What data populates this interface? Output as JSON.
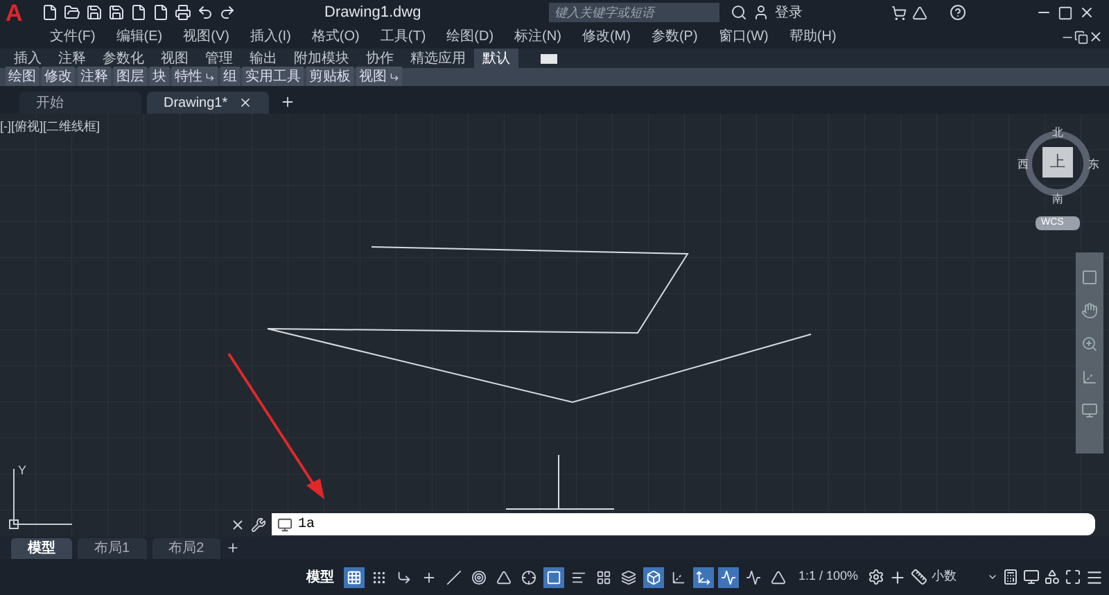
{
  "title_bar": {
    "app_letter": "A",
    "title": "Drawing1.dwg",
    "search": {
      "placeholder": "键入关键字或短语"
    },
    "sign_in": "登录"
  },
  "menu": [
    "文件(F)",
    "编辑(E)",
    "视图(V)",
    "插入(I)",
    "格式(O)",
    "工具(T)",
    "绘图(D)",
    "标注(N)",
    "修改(M)",
    "参数(P)",
    "窗口(W)",
    "帮助(H)"
  ],
  "ribbon_tabs": [
    {
      "label": "插入",
      "selected": false
    },
    {
      "label": "注释",
      "selected": false
    },
    {
      "label": "参数化",
      "selected": false
    },
    {
      "label": "视图",
      "selected": false
    },
    {
      "label": "管理",
      "selected": false
    },
    {
      "label": "输出",
      "selected": false
    },
    {
      "label": "附加模块",
      "selected": false
    },
    {
      "label": "协作",
      "selected": false
    },
    {
      "label": "精选应用",
      "selected": false
    },
    {
      "label": "默认",
      "selected": true
    }
  ],
  "panels": [
    {
      "label": "绘图",
      "more": false
    },
    {
      "label": "修改",
      "more": false
    },
    {
      "label": "注释",
      "more": false
    },
    {
      "label": "图层",
      "more": false
    },
    {
      "label": "块",
      "more": false
    },
    {
      "label": "特性",
      "more": true
    },
    {
      "label": "组",
      "more": false
    },
    {
      "label": "实用工具",
      "more": false
    },
    {
      "label": "剪贴板",
      "more": false
    },
    {
      "label": "视图",
      "more": true
    }
  ],
  "doc_tabs": [
    {
      "label": "开始",
      "selected": false,
      "closable": false
    },
    {
      "label": "Drawing1*",
      "selected": true,
      "closable": true
    }
  ],
  "viewport_label": "[-][俯视][二维线框]",
  "viewcube": {
    "north": "北",
    "south": "南",
    "east": "东",
    "west": "西",
    "face": "上",
    "ucs": "WCS"
  },
  "ucs_icon": {
    "y": "Y"
  },
  "command_line": {
    "value": "1a"
  },
  "layout_tabs": [
    {
      "label": "模型",
      "selected": true
    },
    {
      "label": "布局1",
      "selected": false
    },
    {
      "label": "布局2",
      "selected": false
    }
  ],
  "status_bar": {
    "model": "模型",
    "scale": "1:1 / 100%",
    "units": "小数",
    "toggles": [
      {
        "kind": "grid",
        "on": true
      },
      {
        "kind": "snap",
        "on": false
      },
      {
        "kind": "infer",
        "on": false
      },
      {
        "kind": "dynamic",
        "on": false
      },
      {
        "kind": "ortho",
        "on": false
      },
      {
        "kind": "polar",
        "on": false
      },
      {
        "kind": "isodraft",
        "on": false
      },
      {
        "kind": "objtrack",
        "on": false
      },
      {
        "kind": "osnap",
        "on": true
      },
      {
        "kind": "lineweight",
        "on": false
      },
      {
        "kind": "transparency",
        "on": false
      },
      {
        "kind": "selcycle",
        "on": false
      },
      {
        "kind": "osnap3d",
        "on": true
      },
      {
        "kind": "ucs",
        "on": false
      },
      {
        "kind": "gizmo",
        "on": true
      },
      {
        "kind": "annovis",
        "on": true
      },
      {
        "kind": "autoscale",
        "on": false
      },
      {
        "kind": "annoscale",
        "on": false
      }
    ]
  }
}
